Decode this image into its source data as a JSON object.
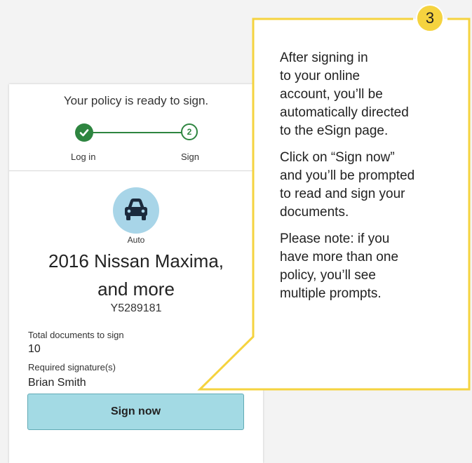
{
  "colors": {
    "accent_yellow": "#f5d33f",
    "step_green": "#2e8540",
    "button_fill": "#a3dae4",
    "car_badge": "#a8d5e8"
  },
  "card": {
    "title": "Your policy is ready to sign.",
    "steps": [
      {
        "label": "Log in",
        "state": "complete",
        "icon": "check-icon"
      },
      {
        "label": "Sign",
        "state": "current",
        "number": "2"
      }
    ],
    "vehicle": {
      "icon": "car-icon",
      "type": "Auto",
      "name_line1": "2016 Nissan Maxima,",
      "name_line2": "and more",
      "policy_number": "Y5289181"
    },
    "fields": [
      {
        "label": "Total documents to sign",
        "value": "10"
      },
      {
        "label": "Required signature(s)",
        "value": "Brian Smith"
      }
    ],
    "sign_button": "Sign now"
  },
  "callout": {
    "step_number": "3",
    "paragraphs": [
      [
        "After signing in",
        "to your online",
        "account, you’ll be",
        "automatically directed",
        "to the eSign page."
      ],
      [
        "Click on “Sign now”",
        "and you’ll be prompted",
        "to read and sign your",
        "documents."
      ],
      [
        "Please note: if you",
        "have more than one",
        "policy, you’ll see",
        "multiple prompts."
      ]
    ]
  }
}
